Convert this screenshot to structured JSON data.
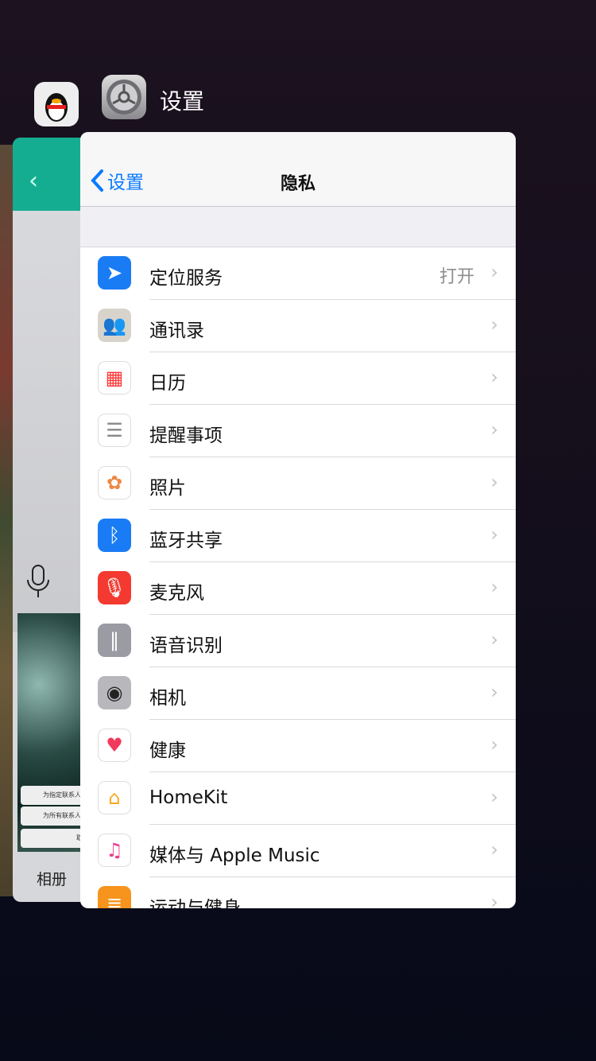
{
  "switcher": {
    "app_title": "设置"
  },
  "qq_card": {
    "album_label": "相册",
    "btn1": "为指定联系人",
    "btn2": "为所有联系人",
    "btn3": "取消"
  },
  "settings": {
    "back_label": "设置",
    "title": "隐私",
    "rows": [
      {
        "label": "定位服务",
        "value": "打开",
        "icon": "location-icon",
        "color": "#1a7cf5"
      },
      {
        "label": "通讯录",
        "icon": "contacts-icon",
        "color": "#d8d4cc"
      },
      {
        "label": "日历",
        "icon": "calendar-icon",
        "color": "#ffffff"
      },
      {
        "label": "提醒事项",
        "icon": "reminders-icon",
        "color": "#ffffff"
      },
      {
        "label": "照片",
        "icon": "photos-icon",
        "color": "#ffffff"
      },
      {
        "label": "蓝牙共享",
        "icon": "bluetooth-icon",
        "color": "#1a7cf5"
      },
      {
        "label": "麦克风",
        "icon": "microphone-icon",
        "color": "#f43a30"
      },
      {
        "label": "语音识别",
        "icon": "speech-recognition-icon",
        "color": "#9a9ba3"
      },
      {
        "label": "相机",
        "icon": "camera-icon",
        "color": "#b8b8bc"
      },
      {
        "label": "健康",
        "icon": "health-icon",
        "color": "#ffffff"
      },
      {
        "label": "HomeKit",
        "icon": "home-icon",
        "color": "#ffffff"
      },
      {
        "label": "媒体与 Apple Music",
        "icon": "music-icon",
        "color": "#ffffff"
      },
      {
        "label": "运动与健身",
        "icon": "motion-icon",
        "color": "#f7941d"
      }
    ]
  }
}
